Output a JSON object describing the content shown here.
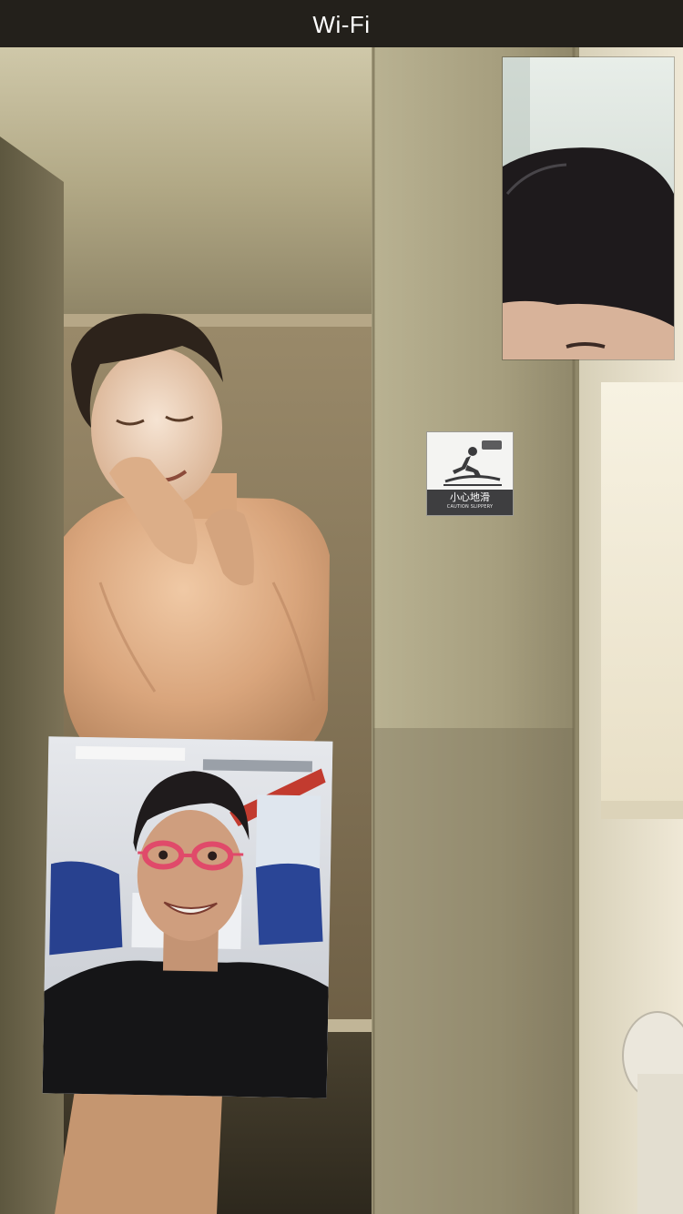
{
  "status_bar": {
    "network": "Wi-Fi"
  },
  "call": {
    "remote_video_label": "remote-participant-video",
    "self_view_label": "self-view-preview"
  },
  "sign": {
    "text_zh": "小心地滑",
    "text_en": "CAUTION SLIPPERY",
    "icon": "slippery-floor-icon"
  },
  "colors": {
    "status_bar_bg": "#23201b",
    "status_text": "#ffffff",
    "sign_bg": "#f4f4f2",
    "sign_band": "#3e3e40"
  }
}
